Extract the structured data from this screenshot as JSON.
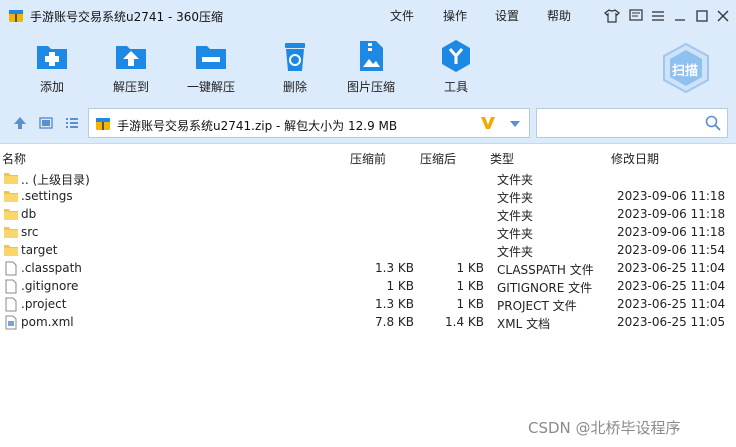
{
  "window": {
    "title": "手游账号交易系统u2741 - 360压缩",
    "menus": [
      "文件",
      "操作",
      "设置",
      "帮助"
    ]
  },
  "toolbar": {
    "add": "添加",
    "extract_to": "解压到",
    "one_click_extract": "一键解压",
    "delete": "删除",
    "image_compress": "图片压缩",
    "tools": "工具",
    "scan": "扫描"
  },
  "address": {
    "path": "手游账号交易系统u2741.zip - 解包大小为 12.9 MB",
    "search_placeholder": ""
  },
  "columns": {
    "name": "名称",
    "before": "压缩前",
    "after": "压缩后",
    "type": "类型",
    "modified": "修改日期"
  },
  "files": [
    {
      "name": ".. (上级目录)",
      "before": "",
      "after": "",
      "type": "文件夹",
      "modified": "",
      "icon": "folder-icon"
    },
    {
      "name": ".settings",
      "before": "",
      "after": "",
      "type": "文件夹",
      "modified": "2023-09-06 11:18",
      "icon": "folder-icon"
    },
    {
      "name": "db",
      "before": "",
      "after": "",
      "type": "文件夹",
      "modified": "2023-09-06 11:18",
      "icon": "folder-icon"
    },
    {
      "name": "src",
      "before": "",
      "after": "",
      "type": "文件夹",
      "modified": "2023-09-06 11:18",
      "icon": "folder-icon"
    },
    {
      "name": "target",
      "before": "",
      "after": "",
      "type": "文件夹",
      "modified": "2023-09-06 11:54",
      "icon": "folder-icon"
    },
    {
      "name": ".classpath",
      "before": "1.3 KB",
      "after": "1 KB",
      "type": "CLASSPATH 文件",
      "modified": "2023-06-25 11:04",
      "icon": "file-icon"
    },
    {
      "name": ".gitignore",
      "before": "1 KB",
      "after": "1 KB",
      "type": "GITIGNORE 文件",
      "modified": "2023-06-25 11:04",
      "icon": "file-icon"
    },
    {
      "name": ".project",
      "before": "1.3 KB",
      "after": "1 KB",
      "type": "PROJECT 文件",
      "modified": "2023-06-25 11:04",
      "icon": "file-icon"
    },
    {
      "name": "pom.xml",
      "before": "7.8 KB",
      "after": "1.4 KB",
      "type": "XML 文档",
      "modified": "2023-06-25 11:05",
      "icon": "xml-file-icon"
    }
  ],
  "watermark": "CSDN @北桥毕设程序"
}
